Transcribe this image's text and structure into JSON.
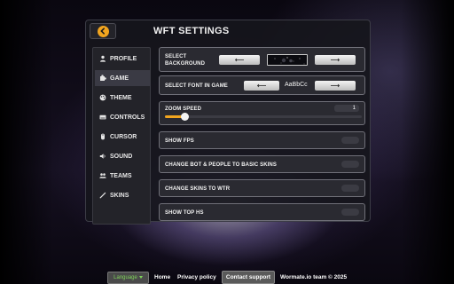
{
  "header": {
    "title": "WFT SETTINGS",
    "back_icon": "chevron-left-icon"
  },
  "sidebar": {
    "items": [
      {
        "label": "PROFILE",
        "icon": "user-icon",
        "active": false
      },
      {
        "label": "GAME",
        "icon": "puzzle-icon",
        "active": true
      },
      {
        "label": "THEME",
        "icon": "palette-icon",
        "active": false
      },
      {
        "label": "CONTROLS",
        "icon": "keyboard-icon",
        "active": false
      },
      {
        "label": "CURSOR",
        "icon": "mouse-icon",
        "active": false
      },
      {
        "label": "SOUND",
        "icon": "speaker-icon",
        "active": false
      },
      {
        "label": "TEAMS",
        "icon": "group-icon",
        "active": false
      },
      {
        "label": "SKINS",
        "icon": "brush-icon",
        "active": false
      }
    ]
  },
  "settings": {
    "background": {
      "label": "SELECT BACKGROUND"
    },
    "font": {
      "label": "SELECT FONT IN GAME",
      "sample": "AaBbCc"
    },
    "zoom": {
      "label": "ZOOM SPEED",
      "value": "1",
      "level": 0.1
    },
    "toggles": [
      {
        "label": "SHOW FPS",
        "on": false
      },
      {
        "label": "CHANGE BOT & PEOPLE TO BASIC SKINS",
        "on": false
      },
      {
        "label": "CHANGE SKINS TO WTR",
        "on": false
      },
      {
        "label": "SHOW TOP HS",
        "on": false
      }
    ]
  },
  "footer": {
    "language_label": "Language",
    "home": "Home",
    "privacy": "Privacy policy",
    "contact": "Contact support",
    "copyright": "Wormate.io team © 2025"
  },
  "colors": {
    "accent": "#f2a51f",
    "language_text": "#7fd35a"
  }
}
